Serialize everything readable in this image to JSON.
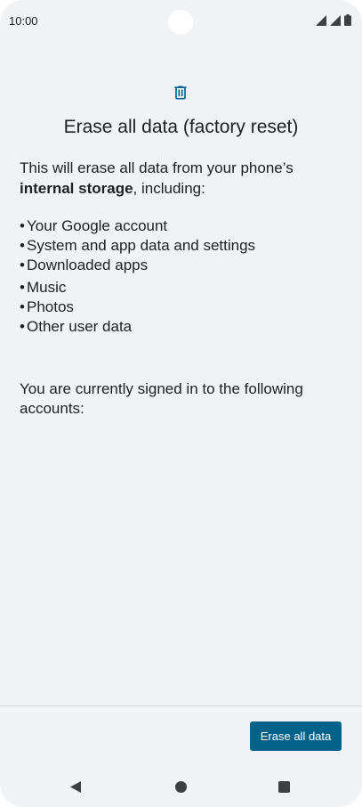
{
  "status_bar": {
    "time": "10:00"
  },
  "screen": {
    "title": "Erase all data (factory reset)",
    "intro_text": "This will erase all data from your phone’s",
    "intro_bold": "internal storage",
    "intro_tail": ", including:",
    "items": [
      "Your Google account",
      "System and app data and settings",
      "Downloaded apps",
      "Music",
      "Photos",
      "Other user data"
    ],
    "bullet": "•",
    "accounts_text": "You are currently signed in to the following accounts:"
  },
  "footer": {
    "erase_button_label": "Erase all data"
  },
  "colors": {
    "accent": "#03618a",
    "background": "#f1f2f5",
    "text": "#202124"
  }
}
